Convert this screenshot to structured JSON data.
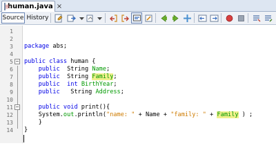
{
  "tab": {
    "label": "human.java",
    "close": "×",
    "icon": "java-file-icon"
  },
  "toolbar": {
    "source_label": "Source",
    "history_label": "History",
    "icons": [
      "last-edit-icon",
      "back-icon",
      "forward-icon",
      "find-previous-icon",
      "find-next-icon",
      "find-selection-icon",
      "toggle-highlight-icon",
      "previous-bookmark-icon",
      "next-bookmark-icon",
      "toggle-bookmark-icon",
      "shift-left-icon",
      "shift-right-icon",
      "start-macro-icon",
      "stop-macro-icon",
      "comment-icon",
      "uncomment-icon"
    ]
  },
  "editor": {
    "line_numbers": [
      "1",
      "2",
      "3",
      "4",
      "5",
      "6",
      "7",
      "8",
      "9",
      "10",
      "11",
      "12",
      "13",
      "14"
    ],
    "lines": {
      "l3_kw": "package",
      "l3_rest": " abs;",
      "l5_kw": "public class",
      "l5_rest": " human {",
      "l6_kw": "public",
      "l6_type": "  String ",
      "l6_field": "Name",
      "l6_end": ";",
      "l7_kw": "public",
      "l7_type": "  String ",
      "l7_field": "Family",
      "l7_end": ";",
      "l8_kw": "public",
      "l8_sp": "  ",
      "l8_kw2": "int",
      "l8_sp2": " ",
      "l8_field": "BirthYear",
      "l8_end": ";",
      "l9_kw": "public",
      "l9_type": "   String ",
      "l9_field": "Address",
      "l9_end": ";",
      "l11_kw": "public void",
      "l11_rest": " print(){",
      "l12_a": "System.",
      "l12_out": "out",
      "l12_b": ".println(",
      "l12_s1": "\"name: \"",
      "l12_c": " + Name + ",
      "l12_s2": "\"family: \"",
      "l12_d": " + ",
      "l12_fam": "Family",
      "l12_e": " ) ;",
      "l13": "}",
      "l14": "}"
    }
  },
  "colors": {
    "keyword": "#0000e6",
    "field": "#009900",
    "string": "#ce7b00",
    "highlight": "#f0f08c"
  }
}
